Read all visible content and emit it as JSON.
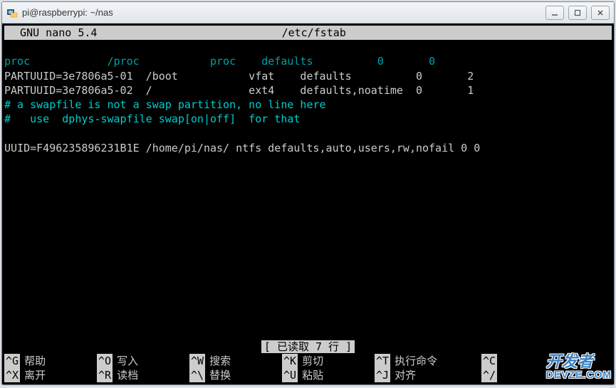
{
  "window": {
    "title": "pi@raspberrypi: ~/nas"
  },
  "nano": {
    "version": "  GNU nano 5.4",
    "filename": "/etc/fstab",
    "status": "[ 已读取 7 行 ]"
  },
  "lines": {
    "l1": "proc            /proc           proc    defaults          0       0",
    "l2": "PARTUUID=3e7806a5-01  /boot           vfat    defaults          0       2",
    "l3": "PARTUUID=3e7806a5-02  /               ext4    defaults,noatime  0       1",
    "l4": "# a swapfile is not a swap partition, no line here",
    "l5": "#   use  dphys-swapfile swap[on|off]  for that",
    "l6": "",
    "l7": "UUID=F496235896231B1E /home/pi/nas/ ntfs defaults,auto,users,rw,nofail 0 0"
  },
  "shortcuts": {
    "row1": [
      {
        "key": "^G",
        "label": "帮助"
      },
      {
        "key": "^O",
        "label": "写入"
      },
      {
        "key": "^W",
        "label": "搜索"
      },
      {
        "key": "^K",
        "label": "剪切"
      },
      {
        "key": "^T",
        "label": "执行命令"
      },
      {
        "key": "^C",
        "label": ""
      }
    ],
    "row2": [
      {
        "key": "^X",
        "label": "离开"
      },
      {
        "key": "^R",
        "label": "读档"
      },
      {
        "key": "^\\",
        "label": "替换"
      },
      {
        "key": "^U",
        "label": "粘贴"
      },
      {
        "key": "^J",
        "label": "对齐"
      },
      {
        "key": "^/",
        "label": ""
      }
    ]
  },
  "watermark": {
    "top": "开发者",
    "bottom": "DEVZE.COM"
  }
}
